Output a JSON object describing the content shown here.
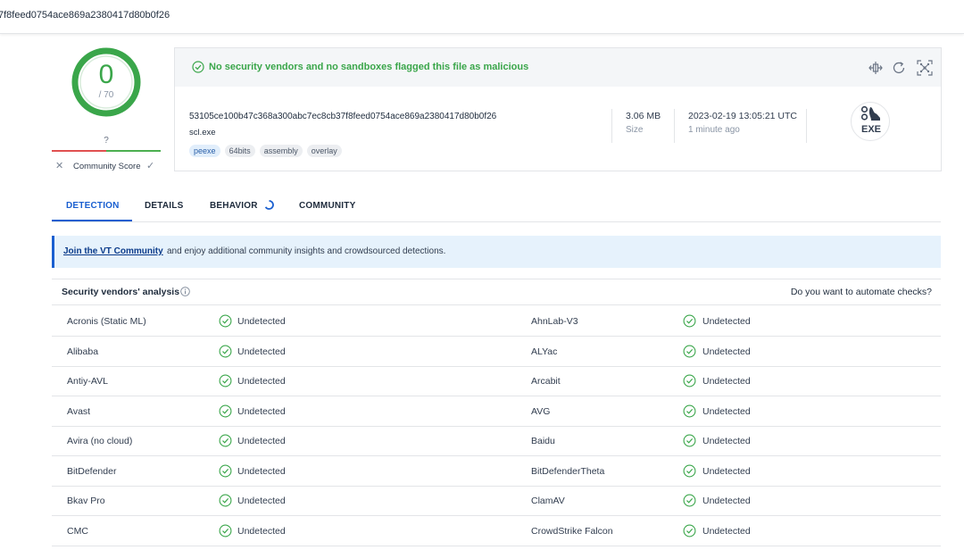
{
  "address_bar": {
    "hash_fragment": "7f8feed0754ace869a2380417d80b0f26"
  },
  "score": {
    "detections": "0",
    "total": "/ 70",
    "color": "#3aa64a"
  },
  "community_score": {
    "value": "?",
    "label": "Community Score"
  },
  "summary": {
    "verdict": "No security vendors and no sandboxes flagged this file as malicious",
    "actions": [
      {
        "name": "compare-icon"
      },
      {
        "name": "reanalyze-icon"
      },
      {
        "name": "graph-icon"
      }
    ],
    "sha256": "53105ce100b47c368a300abc7ec8cb37f8feed0754ace869a2380417d80b0f26",
    "file_name": "scl.exe",
    "tags": [
      "peexe",
      "64bits",
      "assembly",
      "overlay"
    ],
    "size_value": "3.06 MB",
    "size_label": "Size",
    "date_value": "2023-02-19 13:05:21 UTC",
    "date_label": "1 minute ago",
    "file_type": "EXE"
  },
  "tabs": [
    {
      "label": "DETECTION",
      "active": true
    },
    {
      "label": "DETAILS",
      "active": false
    },
    {
      "label": "BEHAVIOR",
      "active": false
    },
    {
      "label": "COMMUNITY",
      "active": false
    }
  ],
  "join_banner": {
    "link_text": "Join the VT Community",
    "rest_text": "and enjoy additional community insights and crowdsourced detections."
  },
  "vendors_header": {
    "title": "Security vendors' analysis",
    "automate": "Do you want to automate checks?"
  },
  "vendors": [
    {
      "left": "Acronis (Static ML)",
      "left_status": "Undetected",
      "right": "AhnLab-V3",
      "right_status": "Undetected"
    },
    {
      "left": "Alibaba",
      "left_status": "Undetected",
      "right": "ALYac",
      "right_status": "Undetected"
    },
    {
      "left": "Antiy-AVL",
      "left_status": "Undetected",
      "right": "Arcabit",
      "right_status": "Undetected"
    },
    {
      "left": "Avast",
      "left_status": "Undetected",
      "right": "AVG",
      "right_status": "Undetected"
    },
    {
      "left": "Avira (no cloud)",
      "left_status": "Undetected",
      "right": "Baidu",
      "right_status": "Undetected"
    },
    {
      "left": "BitDefender",
      "left_status": "Undetected",
      "right": "BitDefenderTheta",
      "right_status": "Undetected"
    },
    {
      "left": "Bkav Pro",
      "left_status": "Undetected",
      "right": "ClamAV",
      "right_status": "Undetected"
    },
    {
      "left": "CMC",
      "left_status": "Undetected",
      "right": "CrowdStrike Falcon",
      "right_status": "Undetected"
    }
  ],
  "colors": {
    "accent": "#1a5fd0",
    "clean": "#3aa64a",
    "banner_bg": "#e6f2fc"
  }
}
